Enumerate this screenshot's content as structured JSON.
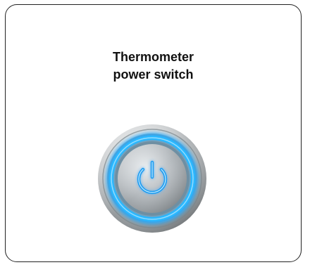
{
  "label": {
    "line1": "Thermometer",
    "line2": "power switch"
  },
  "power_switch": {
    "icon": "power-icon",
    "state": "on",
    "glow_color": "#1ea8ff",
    "ring_color": "#bfc3c6"
  }
}
